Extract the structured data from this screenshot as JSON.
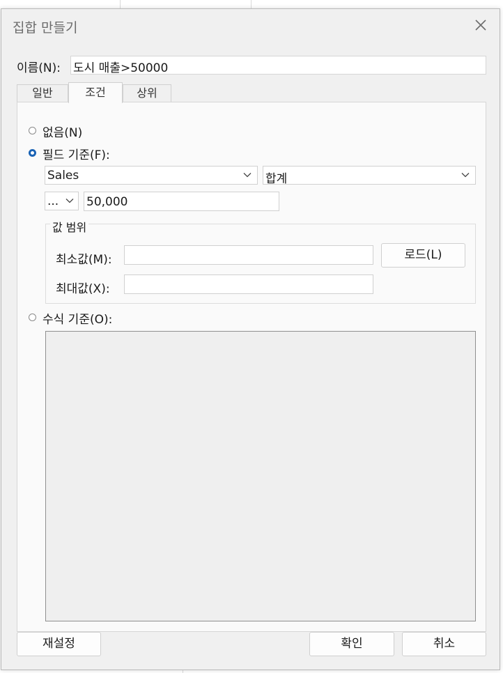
{
  "dialog": {
    "title": "집합 만들기",
    "close_icon": "close-icon",
    "name_label": "이름(N):",
    "name_value": "도시 매출>50000"
  },
  "tabs": [
    {
      "label": "일반",
      "active": false
    },
    {
      "label": "조건",
      "active": true
    },
    {
      "label": "상위",
      "active": false
    }
  ],
  "condition": {
    "none_label": "없음(N)",
    "by_field_label": "필드 기준(F):",
    "by_field_selected": true,
    "field_value": "Sales",
    "aggregation_value": "합계",
    "operator_value": "...",
    "threshold_value": "50,000",
    "range": {
      "title": "값 범위",
      "min_label": "최소값(M):",
      "min_value": "",
      "max_label": "최대값(X):",
      "max_value": "",
      "load_button": "로드(L)"
    },
    "by_formula_label": "수식 기준(O):",
    "formula_value": ""
  },
  "footer": {
    "reset_button": "재설정",
    "ok_button": "확인",
    "cancel_button": "취소"
  },
  "colors": {
    "accent": "#1a63b5",
    "dialog_bg": "#f0f0f0",
    "panel_bg": "#fafafa"
  }
}
